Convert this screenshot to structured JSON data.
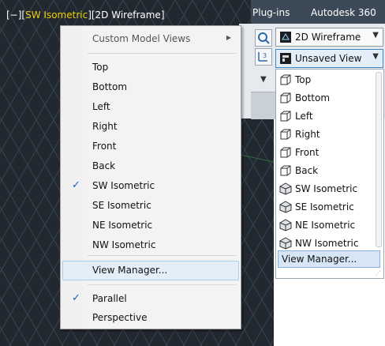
{
  "viewport": {
    "label_prefix": "[−][",
    "label_view": "SW Isometric",
    "label_suffix": "][2D Wireframe]"
  },
  "ribbon": {
    "tabs": [
      "Plug-ins",
      "Autodesk 360"
    ]
  },
  "visual_style_combo": {
    "value": "2D Wireframe",
    "icon": "2d-wireframe-icon"
  },
  "view_combo": {
    "value": "Unsaved View",
    "icon": "unsaved-view-icon"
  },
  "view_list": {
    "items": [
      {
        "label": "Top",
        "icon": "view-cube-top-icon"
      },
      {
        "label": "Bottom",
        "icon": "view-cube-bottom-icon"
      },
      {
        "label": "Left",
        "icon": "view-cube-left-icon"
      },
      {
        "label": "Right",
        "icon": "view-cube-right-icon"
      },
      {
        "label": "Front",
        "icon": "view-cube-front-icon"
      },
      {
        "label": "Back",
        "icon": "view-cube-back-icon"
      },
      {
        "label": "SW Isometric",
        "icon": "iso-sw-icon"
      },
      {
        "label": "SE Isometric",
        "icon": "iso-se-icon"
      },
      {
        "label": "NE Isometric",
        "icon": "iso-ne-icon"
      },
      {
        "label": "NW Isometric",
        "icon": "iso-nw-icon"
      }
    ],
    "manager": "View Manager..."
  },
  "context_menu": {
    "custom_views": "Custom Model Views",
    "views": [
      {
        "label": "Top",
        "checked": false
      },
      {
        "label": "Bottom",
        "checked": false
      },
      {
        "label": "Left",
        "checked": false
      },
      {
        "label": "Right",
        "checked": false
      },
      {
        "label": "Front",
        "checked": false
      },
      {
        "label": "Back",
        "checked": false
      },
      {
        "label": "SW Isometric",
        "checked": true
      },
      {
        "label": "SE Isometric",
        "checked": false
      },
      {
        "label": "NE Isometric",
        "checked": false
      },
      {
        "label": "NW Isometric",
        "checked": false
      }
    ],
    "manager": "View Manager...",
    "projection": [
      {
        "label": "Parallel",
        "checked": true
      },
      {
        "label": "Perspective",
        "checked": false
      }
    ],
    "check_glyph": "✓"
  },
  "colors": {
    "viewport_bg": "#222830",
    "label_highlight": "#f0d000",
    "accent": "#1a5fb4"
  }
}
